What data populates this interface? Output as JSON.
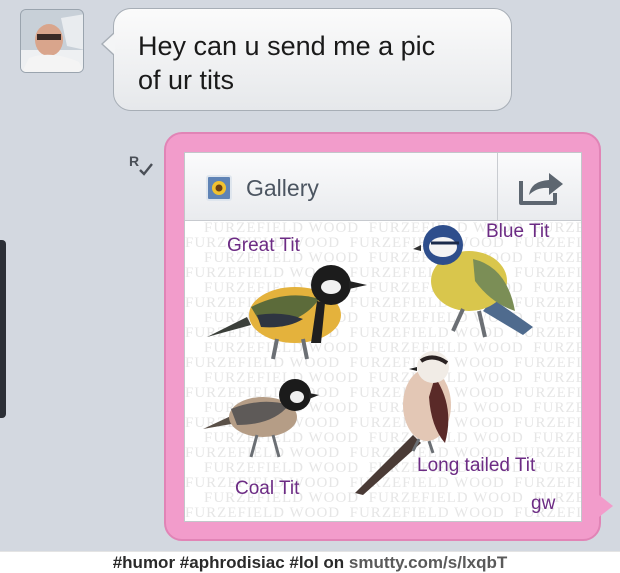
{
  "incoming_message": {
    "line1": "Hey can u send me a pic",
    "line2": "of ur tits"
  },
  "attachment": {
    "title": "Gallery",
    "icons": {
      "gallery": "sunflower-photo-icon",
      "share": "share-arrow-icon",
      "read": "read-receipt-icon"
    },
    "birds": [
      {
        "label": "Great Tit"
      },
      {
        "label": "Blue Tit"
      },
      {
        "label": "Coal Tit"
      },
      {
        "label": "Long tailed Tit"
      }
    ],
    "watermark_text": "FURZEFIELD WOOD",
    "corner_text": "gw"
  },
  "caption": {
    "tags": "#humor #aphrodisiac #lol on",
    "site": "smutty.com/s/lxqbT"
  },
  "colors": {
    "background": "#d3d8e0",
    "outgoing_bubble": "#f29ccb",
    "label_purple": "#6c2b84"
  }
}
